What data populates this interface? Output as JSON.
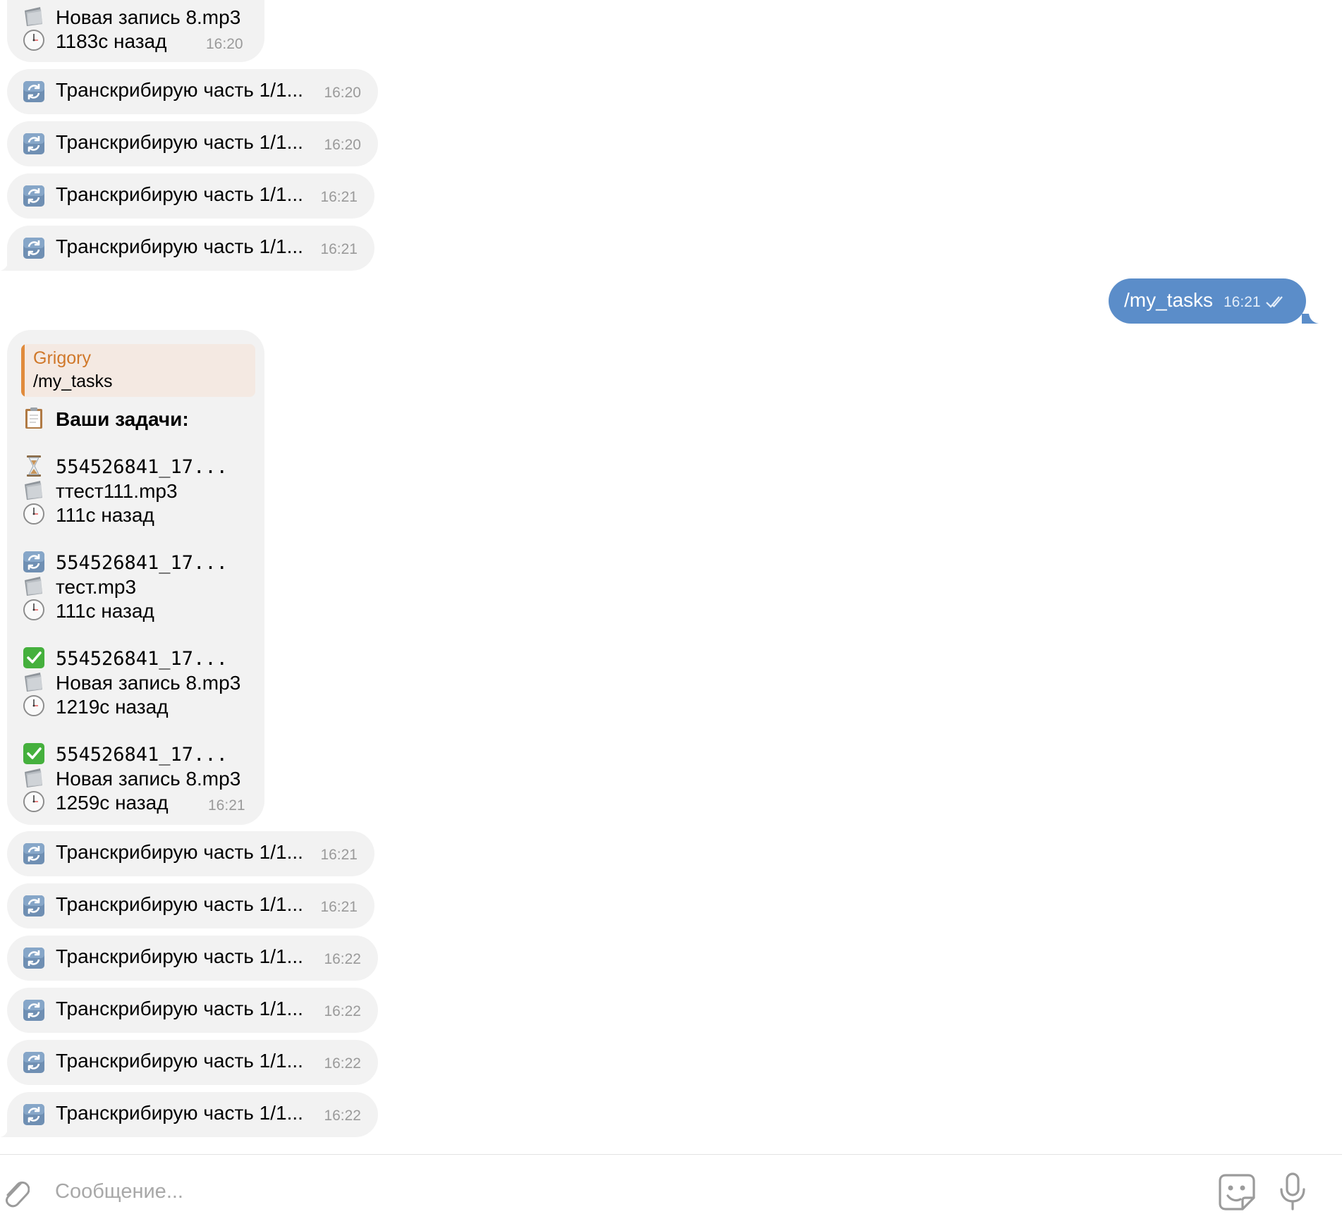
{
  "messages_top": {
    "partial_task": {
      "file": "Новая запись 8.mp3",
      "ago": "1183с назад",
      "time": "16:20"
    },
    "progress": [
      {
        "text": "Транскрибирую часть 1/1...",
        "time": "16:20"
      },
      {
        "text": "Транскрибирую часть 1/1...",
        "time": "16:20"
      },
      {
        "text": "Транскрибирую часть 1/1...",
        "time": "16:21"
      },
      {
        "text": "Транскрибирую часть 1/1...",
        "time": "16:21"
      }
    ]
  },
  "outgoing": {
    "text": "/my_tasks",
    "time": "16:21",
    "status": "read"
  },
  "tasks_message": {
    "reply_author": "Grigory",
    "reply_text": "/my_tasks",
    "heading": "Ваши задачи:",
    "heading_icon": "clipboard-icon",
    "tasks": [
      {
        "status_icon": "hourglass-icon",
        "id": "554526841_17...",
        "file": "ттест111.mp3",
        "ago": "111с назад"
      },
      {
        "status_icon": "refresh-icon",
        "id": "554526841_17...",
        "file": "тест.mp3",
        "ago": "111с назад"
      },
      {
        "status_icon": "check-icon",
        "id": "554526841_17...",
        "file": "Новая запись 8.mp3",
        "ago": "1219с назад"
      },
      {
        "status_icon": "check-icon",
        "id": "554526841_17...",
        "file": "Новая запись 8.mp3",
        "ago": "1259с назад"
      }
    ],
    "time": "16:21"
  },
  "messages_bottom": {
    "progress": [
      {
        "text": "Транскрибирую часть 1/1...",
        "time": "16:21"
      },
      {
        "text": "Транскрибирую часть 1/1...",
        "time": "16:21"
      },
      {
        "text": "Транскрибирую часть 1/1...",
        "time": "16:22"
      },
      {
        "text": "Транскрибирую часть 1/1...",
        "time": "16:22"
      },
      {
        "text": "Транскрибирую часть 1/1...",
        "time": "16:22"
      },
      {
        "text": "Транскрибирую часть 1/1...",
        "time": "16:22"
      }
    ]
  },
  "composer": {
    "placeholder": "Сообщение..."
  },
  "colors": {
    "incoming_bubble": "#f2f2f2",
    "outgoing_bubble": "#5b8dc9",
    "reply_accent": "#e08b3c",
    "timestamp": "#9a9a9a"
  }
}
